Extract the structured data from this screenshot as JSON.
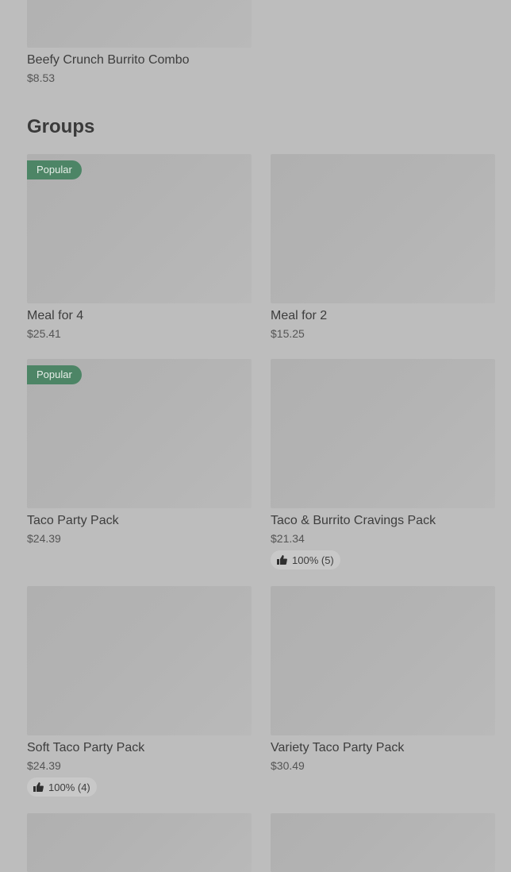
{
  "section_title": "Groups",
  "badge_label": "Popular",
  "items": [
    {
      "name": "Beefy Crunch Burrito Combo",
      "price": "$8.53"
    },
    {
      "name": "Meal for 4",
      "price": "$25.41",
      "badge": "Popular"
    },
    {
      "name": "Meal for 2",
      "price": "$15.25"
    },
    {
      "name": "Taco Party Pack",
      "price": "$24.39",
      "badge": "Popular"
    },
    {
      "name": "Taco & Burrito Cravings Pack",
      "price": "$21.34",
      "rating": "100% (5)"
    },
    {
      "name": "Soft Taco Party Pack",
      "price": "$24.39",
      "rating": "100% (4)"
    },
    {
      "name": "Variety Taco Party Pack",
      "price": "$30.49"
    }
  ],
  "icons": {
    "thumb": "thumbs-up-icon"
  },
  "colors": {
    "badge_bg": "#4d8566",
    "background": "#bdbdbd",
    "image_placeholder": "#b3b3b3"
  }
}
